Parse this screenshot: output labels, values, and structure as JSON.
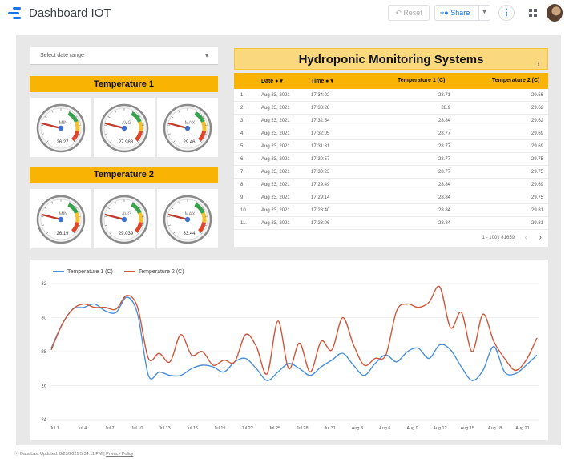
{
  "app": {
    "title": "Dashboard IOT",
    "reset_label": "Reset",
    "share_label": "Share"
  },
  "date_range": {
    "label": "Select date range"
  },
  "sections": {
    "temp1_title": "Temperature 1",
    "temp2_title": "Temperature 2"
  },
  "gauges": {
    "t1": [
      {
        "label": "MIN",
        "value": "26.27"
      },
      {
        "label": "AVG",
        "value": "27.988"
      },
      {
        "label": "MAX",
        "value": "29.46"
      }
    ],
    "t2": [
      {
        "label": "MIN",
        "value": "26.19"
      },
      {
        "label": "AVG",
        "value": "29.039"
      },
      {
        "label": "MAX",
        "value": "33.44"
      }
    ]
  },
  "table": {
    "title": "Hydroponic Monitoring Systems",
    "headers": [
      "Date",
      "Time",
      "Temperature 1 (C)",
      "Temperature 2 (C)"
    ],
    "rows": [
      [
        "1.",
        "Aug 23, 2021",
        "17:34:02",
        "28.71",
        "29.56"
      ],
      [
        "2.",
        "Aug 23, 2021",
        "17:33:28",
        "28.9",
        "29.62"
      ],
      [
        "3.",
        "Aug 23, 2021",
        "17:32:54",
        "28.84",
        "29.62"
      ],
      [
        "4.",
        "Aug 23, 2021",
        "17:32:05",
        "28.77",
        "29.69"
      ],
      [
        "5.",
        "Aug 23, 2021",
        "17:31:31",
        "28.77",
        "29.69"
      ],
      [
        "6.",
        "Aug 23, 2021",
        "17:30:57",
        "28.77",
        "29.75"
      ],
      [
        "7.",
        "Aug 23, 2021",
        "17:30:23",
        "28.77",
        "29.75"
      ],
      [
        "8.",
        "Aug 23, 2021",
        "17:29:49",
        "28.84",
        "29.69"
      ],
      [
        "9.",
        "Aug 23, 2021",
        "17:29:14",
        "28.84",
        "29.75"
      ],
      [
        "10.",
        "Aug 23, 2021",
        "17:28:40",
        "28.84",
        "29.81"
      ],
      [
        "11.",
        "Aug 23, 2021",
        "17:28:06",
        "28.84",
        "29.81"
      ]
    ],
    "pager": "1 - 100 / 81659"
  },
  "chart_data": {
    "type": "line",
    "series": [
      {
        "name": "Temperature 1 (C)",
        "color": "#4a90d9",
        "values": [
          28.2,
          29.6,
          30.5,
          30.6,
          30.8,
          30.4,
          30.3,
          31.2,
          30.2,
          26.6,
          26.8,
          26.6,
          26.6,
          27.0,
          27.2,
          27.1,
          26.8,
          27.4,
          27.6,
          27.0,
          26.3,
          26.8,
          27.3,
          27.0,
          26.6,
          27.1,
          27.5,
          27.9,
          27.2,
          26.6,
          27.3,
          27.8,
          27.4,
          28.0,
          28.2,
          27.6,
          28.4,
          28.1,
          27.1,
          26.3,
          26.9,
          28.3,
          26.8,
          26.7,
          27.2,
          27.8
        ]
      },
      {
        "name": "Temperature 2 (C)",
        "color": "#d0573a",
        "values": [
          28.1,
          29.6,
          30.5,
          30.8,
          30.6,
          30.6,
          30.5,
          31.3,
          30.6,
          27.6,
          27.9,
          27.4,
          29.0,
          27.8,
          28.0,
          27.2,
          27.5,
          27.4,
          29.0,
          28.3,
          26.7,
          29.8,
          27.0,
          28.5,
          26.8,
          28.6,
          28.1,
          30.0,
          28.4,
          27.2,
          27.6,
          27.8,
          30.4,
          30.8,
          30.6,
          30.9,
          31.8,
          29.4,
          30.3,
          28.0,
          30.2,
          28.6,
          27.6,
          26.9,
          27.5,
          28.8
        ]
      }
    ],
    "x_ticks": [
      "Jul 1",
      "Jul 4",
      "Jul 7",
      "Jul 10",
      "Jul 13",
      "Jul 16",
      "Jul 19",
      "Jul 22",
      "Jul 25",
      "Jul 28",
      "Jul 31",
      "Aug 3",
      "Aug 6",
      "Aug 9",
      "Aug 12",
      "Aug 15",
      "Aug 18",
      "Aug 21"
    ],
    "y_ticks": [
      "24",
      "26",
      "28",
      "30",
      "32"
    ],
    "ylim": [
      24,
      32
    ],
    "legend_position": "top-left",
    "grid": true
  },
  "footer": {
    "text": "Data Last Updated: 8/23/2021 5:34:11 PM | ",
    "link": "Privacy Policy"
  }
}
